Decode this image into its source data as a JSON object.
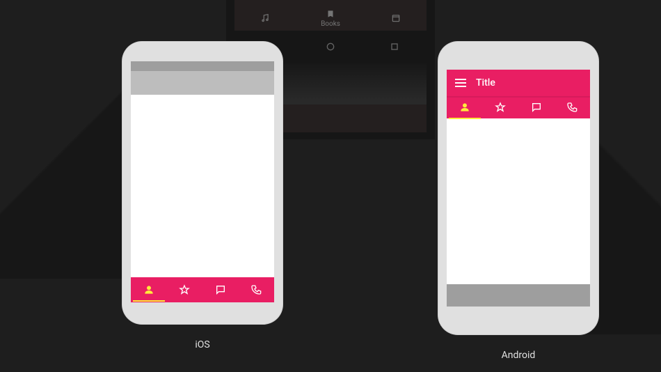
{
  "background_tabs": {
    "center_label": "Books"
  },
  "devices": {
    "ios": {
      "label": "iOS",
      "tabs": [
        {
          "name": "person",
          "active": true
        },
        {
          "name": "star",
          "active": false
        },
        {
          "name": "message",
          "active": false
        },
        {
          "name": "phone",
          "active": false
        }
      ]
    },
    "android": {
      "label": "Android",
      "appbar_title": "Title",
      "tabs": [
        {
          "name": "person",
          "active": true
        },
        {
          "name": "star",
          "active": false
        },
        {
          "name": "message",
          "active": false
        },
        {
          "name": "phone",
          "active": false
        }
      ]
    }
  },
  "colors": {
    "accent": "#e91e63",
    "active_icon": "#ffeb3b",
    "inactive_icon": "#ffffff",
    "dark_bg": "#1e1e1e",
    "grey_mid": "#bdbdbd",
    "grey_dark": "#9e9e9e"
  }
}
